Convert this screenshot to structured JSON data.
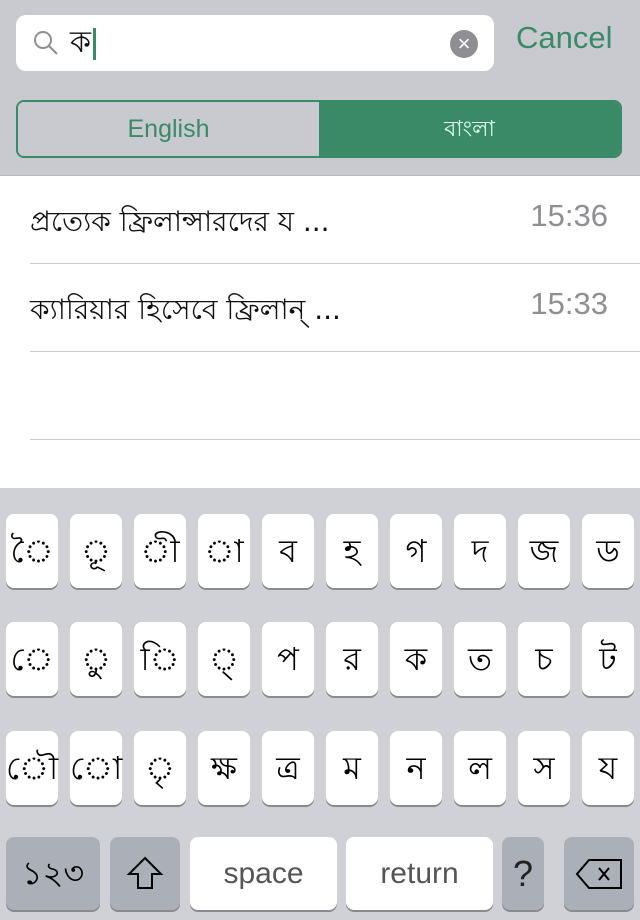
{
  "search": {
    "query": "ক",
    "clear_icon": "clear-icon",
    "cancel_label": "Cancel"
  },
  "segment": {
    "options": [
      "English",
      "বাংলা"
    ],
    "selected": "বাংলা"
  },
  "accent": "#3a8a68",
  "results": [
    {
      "title": "প্রত্যেক ফ্রিলান্সারদের য ...",
      "time": "15:36"
    },
    {
      "title": "ক্যারিয়ার হিসেবে ফ্রিলান্ ...",
      "time": "15:33"
    }
  ],
  "keyboard": {
    "row1": [
      "◌ৈ",
      "◌ূ",
      "◌ী",
      "◌া",
      "ব",
      "হ",
      "গ",
      "দ",
      "জ",
      "ড"
    ],
    "row2": [
      "◌ে",
      "◌ু",
      "◌ি",
      "◌্",
      "প",
      "র",
      "ক",
      "ত",
      "চ",
      "ট"
    ],
    "row3": [
      "◌ৌ",
      "◌ো",
      "◌ৃ",
      "ক্ষ",
      "ত্র",
      "ম",
      "ন",
      "ল",
      "স",
      "য"
    ],
    "numbers_label": "১২৩",
    "space_label": "space",
    "return_label": "return",
    "question_label": "?"
  }
}
